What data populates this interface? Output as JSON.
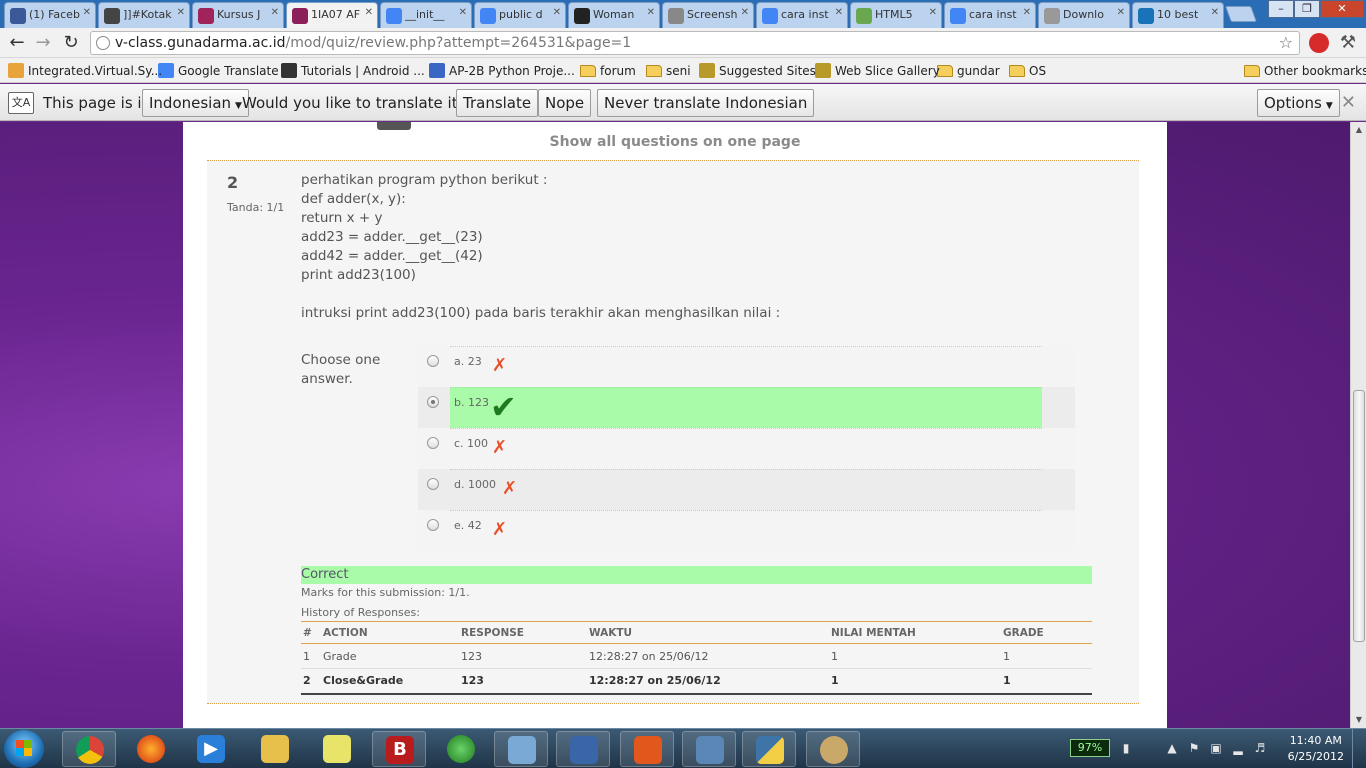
{
  "browser": {
    "tabs": [
      {
        "label": "(1) Faceb",
        "icon_color": "#3b5998",
        "icon": "facebook-icon"
      },
      {
        "label": "]]#Kotak",
        "icon_color": "#444444",
        "icon": "site-icon"
      },
      {
        "label": "Kursus J",
        "icon_color": "#a0245a",
        "icon": "site-icon"
      },
      {
        "label": "1IA07 AF",
        "icon_color": "#8a1f5a",
        "icon": "site-icon",
        "active": true
      },
      {
        "label": "__init__",
        "icon_color": "#4285f4",
        "icon": "google-icon"
      },
      {
        "label": "public d",
        "icon_color": "#4285f4",
        "icon": "google-icon"
      },
      {
        "label": "Woman",
        "icon_color": "#222222",
        "icon": "site-icon"
      },
      {
        "label": "Screensh",
        "icon_color": "#888888",
        "icon": "site-icon"
      },
      {
        "label": "cara inst",
        "icon_color": "#4285f4",
        "icon": "google-icon"
      },
      {
        "label": "HTML5",
        "icon_color": "#6aa84f",
        "icon": "site-icon"
      },
      {
        "label": "cara inst",
        "icon_color": "#4285f4",
        "icon": "google-icon"
      },
      {
        "label": "Downlo",
        "icon_color": "#999999",
        "icon": "site-icon"
      },
      {
        "label": "10 best",
        "icon_color": "#1a73b8",
        "icon": "site-icon"
      }
    ],
    "address": {
      "host": "v-class.gunadarma.ac.id",
      "path": "/mod/quiz/review.php?attempt=264531&page=1"
    },
    "bookmarks": [
      {
        "label": "Integrated.Virtual.Sy...",
        "type": "site",
        "color": "#e8a33a"
      },
      {
        "label": "Google Translate",
        "type": "site",
        "color": "#4285f4"
      },
      {
        "label": "Tutorials | Android ...",
        "type": "site",
        "color": "#333333"
      },
      {
        "label": "AP-2B Python Proje...",
        "type": "site",
        "color": "#3a66c4"
      },
      {
        "label": "forum",
        "type": "folder"
      },
      {
        "label": "seni",
        "type": "folder"
      },
      {
        "label": "Suggested Sites",
        "type": "site",
        "color": "#b79a2a"
      },
      {
        "label": "Web Slice Gallery",
        "type": "site",
        "color": "#b79a2a"
      },
      {
        "label": "gundar",
        "type": "folder"
      },
      {
        "label": "OS",
        "type": "folder"
      }
    ],
    "other_bookmarks": "Other bookmarks"
  },
  "translate_bar": {
    "prefix": "This page is in",
    "language": "Indonesian",
    "question": "Would you like to translate it?",
    "translate": "Translate",
    "nope": "Nope",
    "never": "Never translate Indonesian",
    "options": "Options"
  },
  "quiz": {
    "show_all": "Show all questions on one page",
    "number": "2",
    "mark": "Tanda: 1/1",
    "question_lines": [
      "perhatikan program python berikut :",
      "def adder(x, y):",
      "return x + y",
      "add23 = adder.__get__(23)",
      "add42 = adder.__get__(42)",
      "print add23(100)",
      "",
      "intruksi print add23(100) pada baris terakhir akan menghasilkan nilai :"
    ],
    "choose_label": "Choose one answer.",
    "answers": [
      {
        "label": "a. 23",
        "checked": false,
        "correct": false
      },
      {
        "label": "b. 123",
        "checked": true,
        "correct": true
      },
      {
        "label": "c. 100",
        "checked": false,
        "correct": false
      },
      {
        "label": "d. 1000",
        "checked": false,
        "correct": false
      },
      {
        "label": "e. 42",
        "checked": false,
        "correct": false
      }
    ],
    "feedback": "Correct",
    "marks_text": "Marks for this submission: 1/1.",
    "history_label": "History of Responses:",
    "history_headers": [
      "#",
      "ACTION",
      "RESPONSE",
      "WAKTU",
      "NILAI MENTAH",
      "GRADE"
    ],
    "history_rows": [
      [
        "1",
        "Grade",
        "123",
        "12:28:27 on 25/06/12",
        "1",
        "1"
      ],
      [
        "2",
        "Close&Grade",
        "123",
        "12:28:27 on 25/06/12",
        "1",
        "1"
      ]
    ]
  },
  "taskbar": {
    "battery": "97%",
    "time": "11:40 AM",
    "date": "6/25/2012"
  },
  "colors": {
    "accent_purple": "#6b2a8a",
    "correct_green": "#a9fba9",
    "wrong_red": "#e8502a"
  }
}
